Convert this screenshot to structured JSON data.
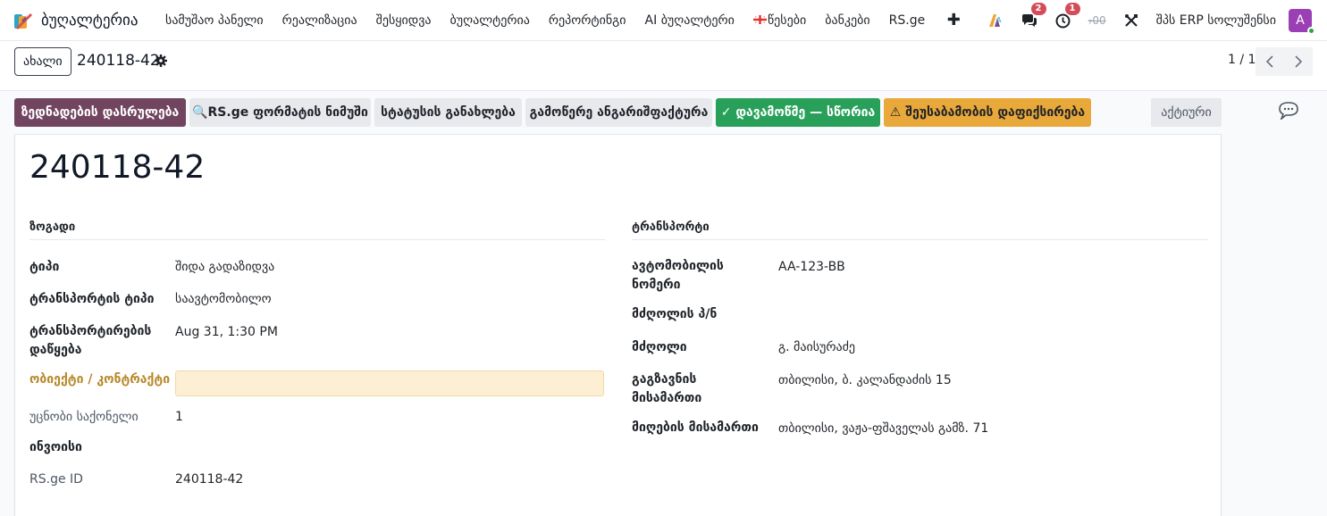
{
  "navbar": {
    "app_title": "ბუღალტერია",
    "menu": [
      "სამუშაო პანელი",
      "რეალიზაცია",
      "შესყიდვა",
      "ბუღალტერია",
      "რეპორტინგი",
      "AI ბუღალტერი",
      "წესები",
      "ბანკები",
      "RS.ge"
    ],
    "plus": "✚",
    "ai_badge_label": "A",
    "messages_count": "2",
    "activities_count": "1",
    "strike_text": "₇00",
    "company": "შპს ERP სოლუშენსი",
    "avatar_letter": "A"
  },
  "control_panel": {
    "new_button": "ახალი",
    "record_title": "240118-42",
    "pager": "1 / 1"
  },
  "actions": {
    "complete": "ზედნადების დასრულება",
    "sample": "🔍RS.ge ფორმატის ნიმუში",
    "refresh": "სტატუსის განახლება",
    "invoice": "გამოწერე ანგარიშფაქტურა",
    "verified": "✓ დავამოწმე — სწორია",
    "mismatch": "⚠ შეუსაბამობის დაფიქსირება",
    "stage": "აქტიური"
  },
  "form": {
    "name": "240118-42",
    "general": {
      "title": "ზოგადი",
      "type_label": "ტიპი",
      "type_value": "შიდა გადაზიდვა",
      "transport_type_label": "ტრანსპორტის ტიპი",
      "transport_type_value": "საავტომობილო",
      "start_label_1": "ტრანსპორტირების",
      "start_label_2": "დაწყება",
      "start_value": "Aug 31, 1:30 PM",
      "object_label": "ობიექტი / კონტრაქტი",
      "object_value": "",
      "unknown_goods_label": "უცნობი საქონელი",
      "unknown_goods_value": "1",
      "invoice_label": "ინვოისი",
      "rsge_id_label": "RS.ge ID",
      "rsge_id_value": "240118-42"
    },
    "transport": {
      "title": "ტრანსპორტი",
      "car_number_label_1": "ავტომობილის",
      "car_number_label_2": "ნომერი",
      "car_number_value": "AA-123-BB",
      "driver_id_label": "მძღოლის პ/ნ",
      "driver_label": "მძღოლი",
      "driver_value": "გ. მაისურაძე",
      "from_label_1": "გაგზავნის",
      "from_label_2": "მისამართი",
      "from_value": "თბილისი, ბ. კალანდაძის 15",
      "to_label": "მიღების მისამართი",
      "to_value": "თბილისი, ვაჟა-ფშაველას გამზ. 71"
    }
  },
  "colors": {
    "primary": "#71445f",
    "success": "#28a05a",
    "warning": "#e9a83a",
    "badge": "#d44c59",
    "avatar": "#9b3fb5",
    "required_bg": "#fcefd3"
  }
}
